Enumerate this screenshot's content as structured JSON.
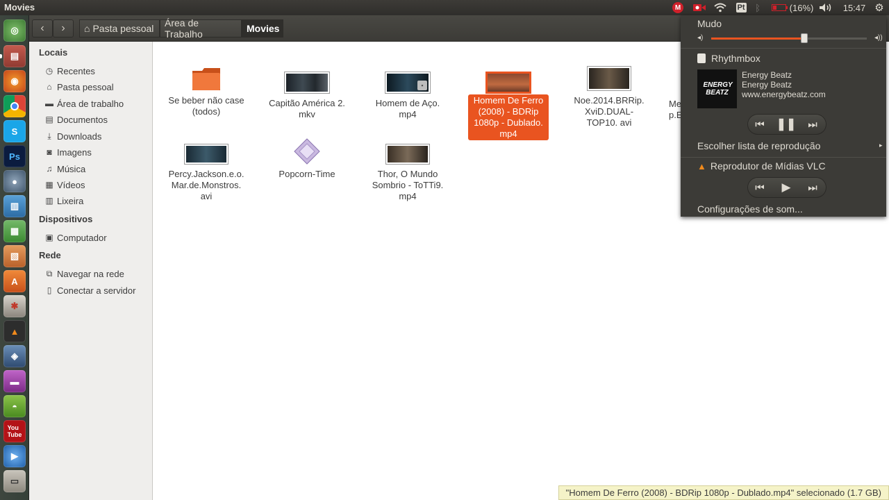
{
  "window": {
    "title": "Movies"
  },
  "indicators": {
    "battery_text": "(16%)",
    "clock": "15:47",
    "keyboard_layout": "Pt",
    "mail_badge": "M"
  },
  "toolbar": {
    "breadcrumbs": [
      "Pasta pessoal",
      "Área de Trabalho",
      "Movies"
    ]
  },
  "sidebar": {
    "sections": {
      "locais": "Locais",
      "dispositivos": "Dispositivos",
      "rede": "Rede"
    },
    "locais": [
      "Recentes",
      "Pasta pessoal",
      "Área de trabalho",
      "Documentos",
      "Downloads",
      "Imagens",
      "Música",
      "Vídeos",
      "Lixeira"
    ],
    "dispositivos": [
      "Computador"
    ],
    "rede": [
      "Navegar na rede",
      "Conectar a servidor"
    ]
  },
  "files": [
    {
      "name": "Se beber não case (todos)",
      "kind": "folder"
    },
    {
      "name": "Capitão América 2. mkv",
      "kind": "video"
    },
    {
      "name": "Homem de Aço. mp4",
      "kind": "video-locked"
    },
    {
      "name": "Homem De Ferro (2008) - BDRip 1080p - Dublado. mp4",
      "kind": "video",
      "selected": true
    },
    {
      "name": "Noe.2014.BRRip. XviD.DUAL-TOP10. avi",
      "kind": "video"
    },
    {
      "name": "Me p.E",
      "kind": "video-partial"
    },
    {
      "name": "Percy.Jackson.e.o. Mar.de.Monstros. avi",
      "kind": "video"
    },
    {
      "name": "Popcorn-Time",
      "kind": "app"
    },
    {
      "name": "Thor, O Mundo Sombrio - ToTTi9. mp4",
      "kind": "video"
    }
  ],
  "status": {
    "text": "\"Homem De Ferro (2008) - BDRip 1080p - Dublado.mp4\" selecionado  (1.7 GB)"
  },
  "sound_menu": {
    "mute_label": "Mudo",
    "volume_percent": 60,
    "player1": {
      "name": "Rhythmbox",
      "track_title": "Energy Beatz",
      "track_artist": "Energy Beatz",
      "track_url": "www.energybeatz.com",
      "album_art_text": "ENERGY BEATZ"
    },
    "playlist_label": "Escolher lista de reprodução",
    "player2": {
      "name": "Reprodutor de Mídias VLC"
    },
    "settings_label": "Configurações de som..."
  },
  "colors": {
    "accent": "#e95420",
    "panel": "#3c3b37",
    "status_bg": "#f5f3c8"
  }
}
